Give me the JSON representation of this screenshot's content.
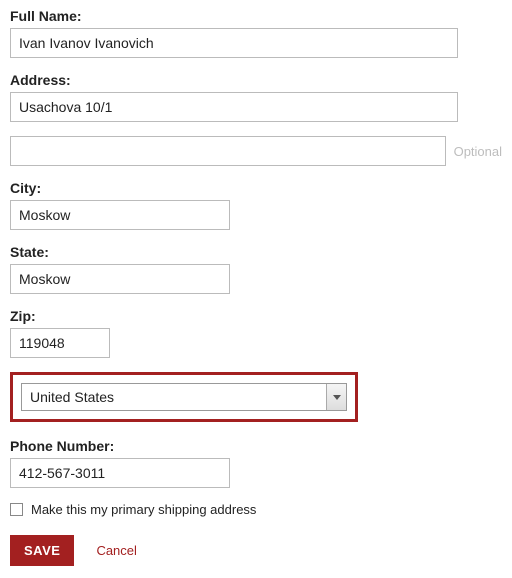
{
  "labels": {
    "fullName": "Full Name:",
    "address": "Address:",
    "city": "City:",
    "state": "State:",
    "zip": "Zip:",
    "phone": "Phone Number:"
  },
  "values": {
    "fullName": "Ivan Ivanov Ivanovich",
    "address1": "Usachova 10/1",
    "address2": "",
    "city": "Moskow",
    "state": "Moskow",
    "zip": "119048",
    "country": "United States",
    "phone": "412-567-3011"
  },
  "hints": {
    "optional": "Optional"
  },
  "checkbox": {
    "primaryLabel": "Make this my primary shipping address",
    "checked": false
  },
  "actions": {
    "save": "SAVE",
    "cancel": "Cancel"
  },
  "highlightColor": "#a32020"
}
